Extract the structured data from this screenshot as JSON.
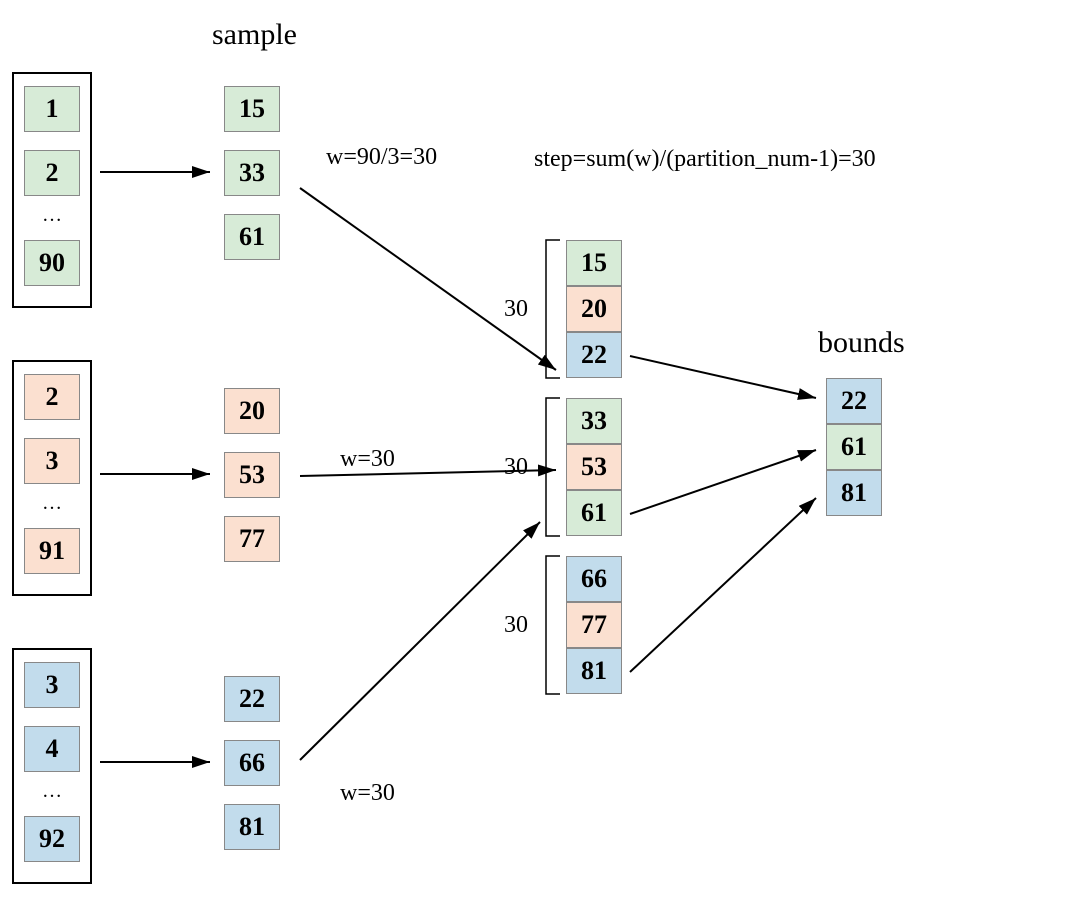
{
  "headings": {
    "sample": "sample",
    "bounds": "bounds"
  },
  "formulas": {
    "w1": "w=90/3=30",
    "w2": "w=30",
    "w3": "w=30",
    "step": "step=sum(w)/(partition_num-1)=30"
  },
  "partitions": {
    "p1": {
      "a": "1",
      "b": "2",
      "dots": "…",
      "c": "90"
    },
    "p2": {
      "a": "2",
      "b": "3",
      "dots": "…",
      "c": "91"
    },
    "p3": {
      "a": "3",
      "b": "4",
      "dots": "…",
      "c": "92"
    }
  },
  "samples": {
    "s1": {
      "a": "15",
      "b": "33",
      "c": "61"
    },
    "s2": {
      "a": "20",
      "b": "53",
      "c": "77"
    },
    "s3": {
      "a": "22",
      "b": "66",
      "c": "81"
    }
  },
  "merged": {
    "r0": "15",
    "r1": "20",
    "r2": "22",
    "r3": "33",
    "r4": "53",
    "r5": "61",
    "r6": "66",
    "r7": "77",
    "r8": "81"
  },
  "weights": {
    "g1": "30",
    "g2": "30",
    "g3": "30"
  },
  "bounds": {
    "b1": "22",
    "b2": "61",
    "b3": "81"
  }
}
